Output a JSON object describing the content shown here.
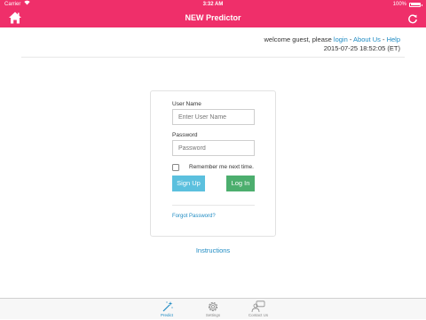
{
  "status_bar": {
    "carrier": "Carrier",
    "time": "3:32 AM",
    "battery": "100%",
    "battery_level": 1.0
  },
  "nav": {
    "title": "NEW Predictor",
    "home_icon": "home-icon",
    "refresh_icon": "refresh-icon"
  },
  "header": {
    "welcome_prefix": "welcome guest, please ",
    "login_link": "login",
    "sep1": " - ",
    "about_link": "About Us",
    "sep2": " - ",
    "help_link": "Help",
    "datetime": "2015-07-25 18:52:05 (ET)"
  },
  "login_form": {
    "username_label": "User Name",
    "username_placeholder": "Enter User Name",
    "username_value": "",
    "password_label": "Password",
    "password_placeholder": "Password",
    "password_value": "",
    "remember_label": "Remember me next time.",
    "remember_checked": false,
    "signup_label": "Sign Up",
    "login_label": "Log In",
    "forgot_label": "Forgot Password?"
  },
  "instructions_link": "Instructions",
  "tabs": [
    {
      "label": "Predict",
      "icon": "magic-wand-icon",
      "active": true
    },
    {
      "label": "Settings",
      "icon": "gear-icon",
      "active": false
    },
    {
      "label": "Contact Us",
      "icon": "contact-icon",
      "active": false
    }
  ],
  "colors": {
    "brand": "#ef2f6a",
    "link": "#1e8bc3",
    "signup": "#5bc0de",
    "login": "#4cae6e"
  }
}
